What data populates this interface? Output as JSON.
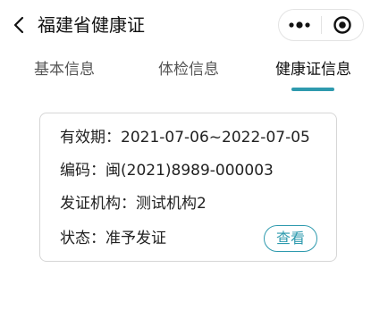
{
  "navbar": {
    "title": "福建省健康证"
  },
  "tabs": [
    {
      "label": "基本信息",
      "active": false
    },
    {
      "label": "体检信息",
      "active": false
    },
    {
      "label": "健康证信息",
      "active": true
    }
  ],
  "card": {
    "validity": {
      "label": "有效期：",
      "value": "2021-07-06~2022-07-05"
    },
    "code": {
      "label": "编码：",
      "value": "闽(2021)8989-000003"
    },
    "issuer": {
      "label": "发证机构：",
      "value": "测试机构2"
    },
    "status": {
      "label": "状态：",
      "value": "准予发证"
    },
    "view_button": "查看"
  },
  "colors": {
    "accent": "#2e9aae",
    "text": "#222222",
    "tab_inactive": "#555555",
    "border": "#d6d6d6"
  },
  "icons": {
    "back": "chevron-left-icon",
    "more": "more-dots-icon",
    "close": "target-circle-icon"
  }
}
